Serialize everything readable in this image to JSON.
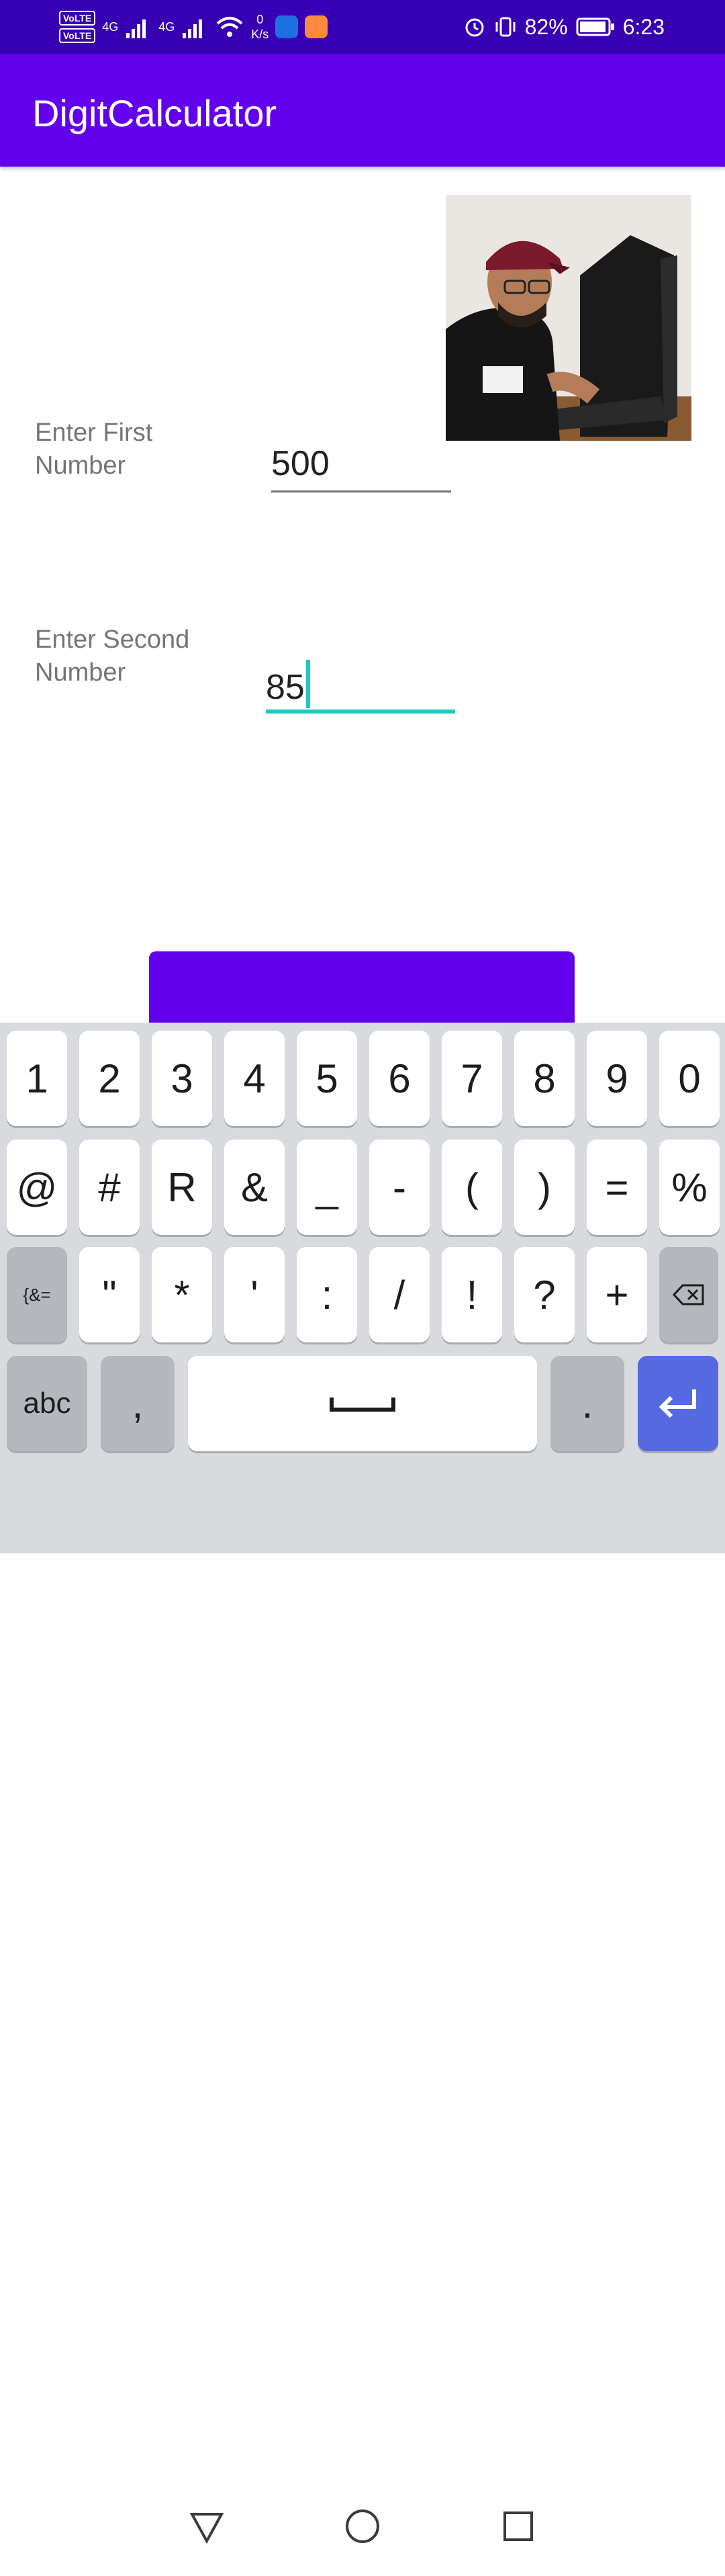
{
  "status_bar": {
    "volte1": "VoLTE",
    "volte2": "VoLTE",
    "sim1": "1",
    "sim2": "2",
    "net1": "4G",
    "net2": "4G",
    "speed_value": "0",
    "speed_unit": "K/s",
    "battery": "82%",
    "time": "6:23"
  },
  "app_bar": {
    "title": "DigitCalculator"
  },
  "form": {
    "first_label": "Enter First Number",
    "first_value": "500",
    "second_label": "Enter Second Number",
    "second_value": "85"
  },
  "keyboard": {
    "row1": [
      "1",
      "2",
      "3",
      "4",
      "5",
      "6",
      "7",
      "8",
      "9",
      "0"
    ],
    "row2": [
      "@",
      "#",
      "R",
      "&",
      "_",
      "-",
      "(",
      ")",
      "=",
      "%"
    ],
    "row3": [
      "{&=",
      "\"",
      "*",
      "'",
      ":",
      "/",
      "!",
      "?",
      "+"
    ],
    "abc": "abc",
    "comma": ",",
    "period": "."
  },
  "colors": {
    "status_bar": "#3700b3",
    "app_bar": "#6200ee",
    "accent": "#1fc9bd",
    "enter_key": "#5569e0"
  }
}
